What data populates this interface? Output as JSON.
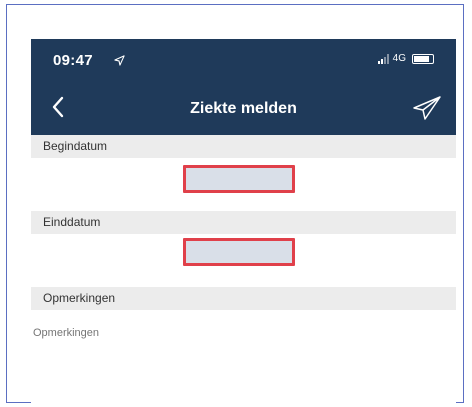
{
  "status_bar": {
    "time": "09:47",
    "network": "4G"
  },
  "nav": {
    "title": "Ziekte melden"
  },
  "form": {
    "begin_label": "Begindatum",
    "begin_value": "",
    "end_label": "Einddatum",
    "end_value": "",
    "remarks_label": "Opmerkingen",
    "remarks_placeholder": "Opmerkingen"
  },
  "colors": {
    "nav_background": "#1f3a5a",
    "highlight_border": "#e0404a",
    "frame_border": "#5b6fc2"
  },
  "icons": {
    "back": "chevron-left-icon",
    "send": "paper-plane-icon",
    "location": "location-arrow-icon"
  }
}
